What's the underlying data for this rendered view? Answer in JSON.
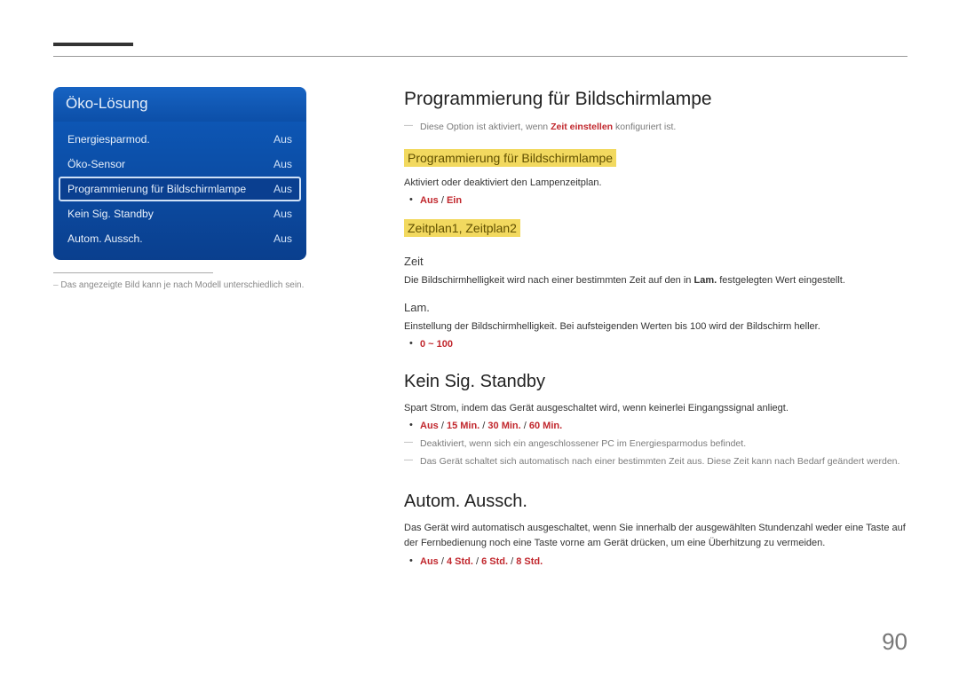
{
  "page_number": "90",
  "menu": {
    "title": "Öko-Lösung",
    "items": [
      {
        "label": "Energiesparmod.",
        "value": "Aus",
        "selected": false
      },
      {
        "label": "Öko-Sensor",
        "value": "Aus",
        "selected": false
      },
      {
        "label": "Programmierung für Bildschirmlampe",
        "value": "Aus",
        "selected": true
      },
      {
        "label": "Kein Sig. Standby",
        "value": "Aus",
        "selected": false
      },
      {
        "label": "Autom. Aussch.",
        "value": "Aus",
        "selected": false
      }
    ],
    "caption": "Das angezeigte Bild kann je nach Modell unterschiedlich sein."
  },
  "content": {
    "h1": "Programmierung für Bildschirmlampe",
    "intro_note_pre": "Diese Option ist aktiviert, wenn ",
    "intro_note_bold": "Zeit einstellen",
    "intro_note_post": " konfiguriert ist.",
    "sec1": {
      "label": "Programmierung für Bildschirmlampe",
      "desc": "Aktiviert oder deaktiviert den Lampenzeitplan.",
      "options": [
        "Aus",
        "Ein"
      ]
    },
    "sec2": {
      "label": "Zeitplan1, Zeitplan2",
      "sub1": {
        "title": "Zeit",
        "desc_pre": "Die Bildschirmhelligkeit wird nach einer bestimmten Zeit auf den in ",
        "desc_bold": "Lam.",
        "desc_post": " festgelegten Wert eingestellt."
      },
      "sub2": {
        "title": "Lam.",
        "desc": "Einstellung der Bildschirmhelligkeit. Bei aufsteigenden Werten bis 100 wird der Bildschirm heller.",
        "options": [
          "0 ~ 100"
        ]
      }
    },
    "sec3": {
      "title": "Kein Sig. Standby",
      "desc": "Spart Strom, indem das Gerät ausgeschaltet wird, wenn keinerlei Eingangssignal anliegt.",
      "options": [
        "Aus",
        "15 Min.",
        "30 Min.",
        "60 Min."
      ],
      "notes": [
        "Deaktiviert, wenn sich ein angeschlossener PC im Energiesparmodus befindet.",
        "Das Gerät schaltet sich automatisch nach einer bestimmten Zeit aus. Diese Zeit kann nach Bedarf geändert werden."
      ]
    },
    "sec4": {
      "title": "Autom. Aussch.",
      "desc": "Das Gerät wird automatisch ausgeschaltet, wenn Sie innerhalb der ausgewählten Stundenzahl weder eine Taste auf der Fernbedienung noch eine Taste vorne am Gerät drücken, um eine Überhitzung zu vermeiden.",
      "options": [
        "Aus",
        "4 Std.",
        "6 Std.",
        "8 Std."
      ]
    }
  }
}
